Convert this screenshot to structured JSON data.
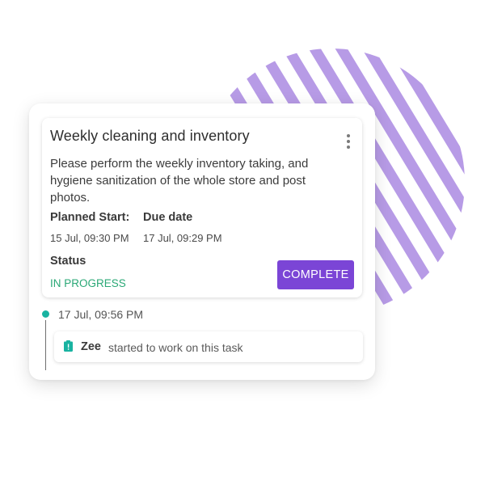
{
  "colors": {
    "accent": "#7b45d6",
    "stripes": "#b79be6",
    "status_in_progress": "#2aa876",
    "timeline_dot": "#19b3a1"
  },
  "task": {
    "title": "Weekly cleaning and inventory",
    "description": "Please perform the weekly inventory taking, and hygiene sanitization of the whole store and post photos.",
    "menu_icon": "more-vertical-icon",
    "planned_start_label": "Planned Start:",
    "planned_start_value": "15 Jul, 09:30 PM",
    "due_date_label": "Due date",
    "due_date_value": "17 Jul, 09:29 PM",
    "status_label": "Status",
    "status_value": "IN PROGRESS",
    "complete_button_label": "COMPLETE"
  },
  "activity": {
    "timestamp": "17 Jul, 09:56 PM",
    "icon": "clipboard-alert-icon",
    "user": "Zee",
    "message": "started to work on this task"
  }
}
